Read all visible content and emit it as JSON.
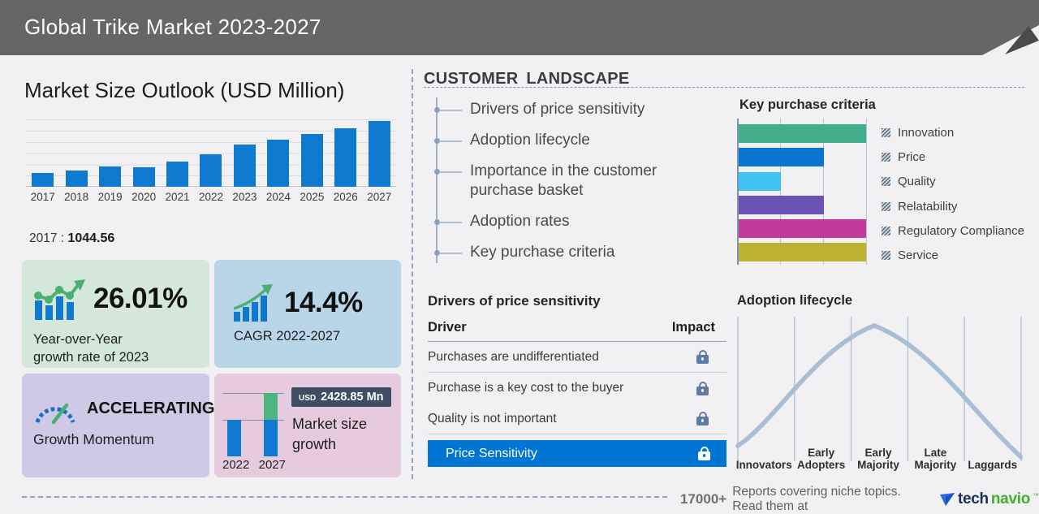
{
  "header": {
    "title": "Global Trike Market 2023-2027"
  },
  "market_size": {
    "title": "Market Size Outlook (USD Million)",
    "anchor_year": "2017",
    "anchor_sep": ":",
    "anchor_value": "1044.56"
  },
  "stats": {
    "yoy": {
      "value": "26.01%",
      "line1": "Year-over-Year",
      "line2": "growth rate of 2023"
    },
    "cagr": {
      "value": "14.4%",
      "label": "CAGR 2022-2027"
    },
    "momentum": {
      "status": "ACCELERATING",
      "label": "Growth Momentum"
    },
    "growth": {
      "currency": "USD",
      "amount": "2428.85 Mn",
      "line1": "Market size",
      "line2": "growth",
      "start_year": "2022",
      "end_year": "2027"
    }
  },
  "customer_landscape": {
    "heading": "CUSTOMER LANDSCAPE",
    "items": [
      "Drivers of price sensitivity",
      "Adoption lifecycle",
      "Importance in the customer purchase basket",
      "Adoption rates",
      "Key purchase criteria"
    ]
  },
  "price_sensitivity": {
    "title": "Drivers of price sensitivity",
    "col_driver": "Driver",
    "col_impact": "Impact",
    "rows": [
      "Purchases are undifferentiated",
      "Purchase is a key cost to the buyer",
      "Quality is not important"
    ],
    "highlight": "Price Sensitivity"
  },
  "footer": {
    "count": "17000+",
    "text": "Reports covering niche topics. Read them at",
    "logo_part1": "tech",
    "logo_part2": "navio",
    "logo_tm": "™"
  },
  "colors": {
    "header_bg": "#666666",
    "page_bg": "#f1f1f3",
    "primary_bar_blue": "#0f79d0",
    "highlight_blue": "#0075d4",
    "growth_green": "#4db582",
    "badge_slate": "#3d4d63",
    "box_green": "#d3e8da",
    "box_blue": "#b9d6e9",
    "box_purple": "#cfc9e5",
    "box_pink": "#e6cade",
    "curve_gray_blue": "#aabdd5",
    "logo_navy": "#1b2f55",
    "logo_green": "#3faf2b"
  },
  "chart_data": [
    {
      "id": "market_size_outlook",
      "type": "bar",
      "title": "Market Size Outlook (USD Million)",
      "categories": [
        "2017",
        "2018",
        "2019",
        "2020",
        "2021",
        "2022",
        "2023",
        "2024",
        "2025",
        "2026",
        "2027"
      ],
      "values": [
        1044.56,
        1275,
        1555,
        1510,
        1935,
        2550,
        3275,
        3655,
        4120,
        4565,
        5120
      ],
      "note": "Only 2017 value (1044.56) is labeled on screen; other values estimated from bar heights",
      "xlabel": "",
      "ylabel": "USD Million",
      "ylim": [
        0,
        5300
      ],
      "grid": true,
      "bar_color": "#0f79d0"
    },
    {
      "id": "key_purchase_criteria",
      "type": "bar",
      "orientation": "horizontal",
      "title": "Key purchase criteria",
      "categories": [
        "Innovation",
        "Price",
        "Quality",
        "Relatability",
        "Regulatory Compliance",
        "Service"
      ],
      "values": [
        3,
        2,
        1,
        2,
        3,
        3
      ],
      "xlim": [
        0,
        3
      ],
      "colors": [
        "#43ae8c",
        "#0b76cf",
        "#3fc3f3",
        "#6a52b4",
        "#c23a9e",
        "#beb233"
      ],
      "legend_position": "right",
      "note": "Unlabeled axis; bar lengths read against gridlines at thirds"
    },
    {
      "id": "adoption_lifecycle",
      "type": "area",
      "title": "Adoption lifecycle",
      "categories": [
        "Innovators",
        "Early Adopters",
        "Early Majority",
        "Late Majority",
        "Laggards"
      ],
      "description": "Bell curve rising from Innovators, peaking near start of Early Majority, falling to Laggards",
      "curve_color": "#aabdd5",
      "grid": true
    },
    {
      "id": "market_size_growth",
      "type": "bar",
      "title": "Market size growth",
      "categories": [
        "2022",
        "2027"
      ],
      "values_relative": [
        1,
        2.2
      ],
      "growth_amount_label": "USD 2428.85 Mn",
      "colors": {
        "base": "#0f79d0",
        "growth": "#4db582"
      }
    }
  ]
}
